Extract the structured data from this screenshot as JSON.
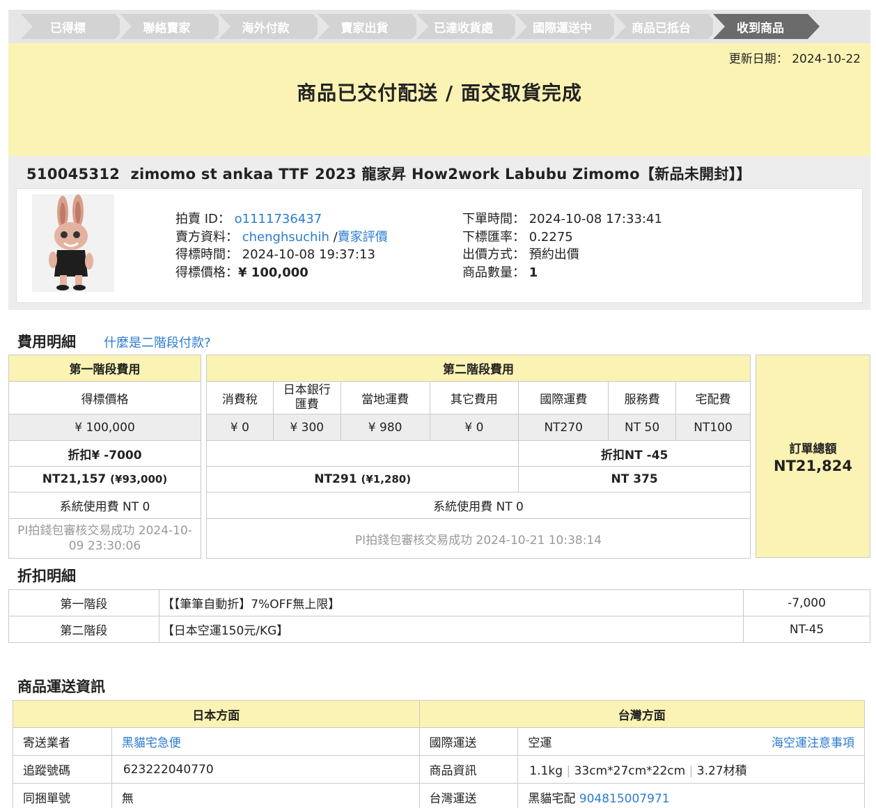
{
  "steps": [
    "已得標",
    "聯絡賣家",
    "海外付款",
    "賣家出貨",
    "已達收貨處",
    "國際運送中",
    "商品已抵台",
    "收到商品"
  ],
  "update": {
    "label": "更新日期：",
    "date": "2024-10-22"
  },
  "status_text": "商品已交付配送 / 面交取貨完成",
  "product": {
    "id": "510045312",
    "title": "zimomo st ankaa TTF 2023 龍家昇 How2work Labubu Zimomo【新品未開封】】",
    "auction_label": "拍賣 ID：",
    "auction_id": "o1111736437",
    "seller_label": "賣方資料：",
    "seller": "chenghsuchih",
    "seller_sep": " /",
    "seller_rating": "賣家評價",
    "won_time_label": "得標時間：",
    "won_time": "2024-10-08 19:37:13",
    "won_price_label": "得標價格：",
    "won_price": "¥ 100,000",
    "order_time_label": "下單時間：",
    "order_time": "2024-10-08 17:33:41",
    "rate_label": "下標匯率：",
    "rate": "0.2275",
    "bid_method_label": "出價方式：",
    "bid_method": "預約出價",
    "qty_label": "商品數量：",
    "qty": "1"
  },
  "fees": {
    "heading": "費用明細",
    "help_link": "什麼是二階段付款?",
    "stage1": {
      "title": "第一階段費用",
      "col": "得標價格",
      "value": "¥ 100,000",
      "discount": "折扣¥ -7000",
      "subtotal_nt": "NT21,157",
      "subtotal_jpy": "(¥93,000)",
      "system_fee": "系統使用費 NT 0",
      "status": "PI拍錢包審核交易成功 2024-10-09 23:30:06"
    },
    "stage2": {
      "title": "第二階段費用",
      "cols": [
        "消費稅",
        "日本銀行匯費",
        "當地運費",
        "其它費用",
        "國際運費",
        "服務費",
        "宅配費"
      ],
      "values": [
        "¥ 0",
        "¥ 300",
        "¥ 980",
        "¥ 0",
        "NT270",
        "NT 50",
        "NT100"
      ],
      "discount": "折扣NT -45",
      "subtotal_nt": "NT291",
      "subtotal_jpy": "(¥1,280)",
      "subtotal2": "NT 375",
      "system_fee": "系統使用費 NT 0",
      "status": "PI拍錢包審核交易成功 2024-10-21 10:38:14"
    },
    "total_label": "訂單總額",
    "total_value": "NT21,824"
  },
  "discounts": {
    "heading": "折扣明細",
    "rows": [
      {
        "stage": "第一階段",
        "desc": "【【筆筆自動折】7%OFF無上限】",
        "amount": "-7,000"
      },
      {
        "stage": "第二階段",
        "desc": "【日本空運150元/KG】",
        "amount": "NT-45"
      }
    ]
  },
  "shipping": {
    "heading": "商品運送資訊",
    "jp_title": "日本方面",
    "tw_title": "台灣方面",
    "rows": [
      {
        "jp_label": "寄送業者",
        "jp_value": "黑貓宅急便",
        "tw_label": "國際運送",
        "tw_value": "空運",
        "tw_link": "海空運注意事項"
      },
      {
        "jp_label": "追蹤號碼",
        "jp_value": "623222040770",
        "tw_label": "商品資訊",
        "tw_weight": "1.1kg",
        "tw_size": "33cm*27cm*22cm",
        "tw_volume": "3.27材積"
      },
      {
        "jp_label": "同捆單號",
        "jp_value": "無",
        "tw_label": "台灣運送",
        "tw_carrier": "黑貓宅配",
        "tw_tracking": "904815007971"
      }
    ]
  }
}
